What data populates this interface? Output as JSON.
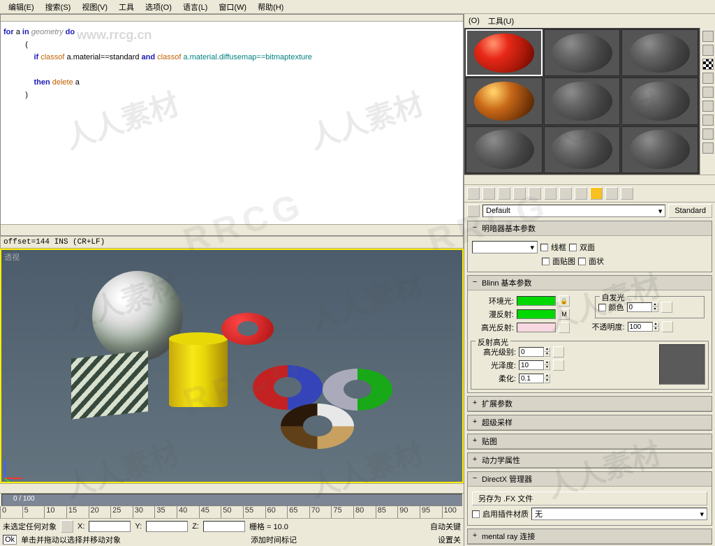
{
  "menubar": {
    "edit": "编辑(E)",
    "search": "搜索(S)",
    "view": "视图(V)",
    "tools": "工具",
    "options": "选项(O)",
    "language": "语言(L)",
    "window": "窗口(W)",
    "help": "帮助(H)"
  },
  "watermark_url": "www.rrcg.cn",
  "watermark_text": "人人素材",
  "script": {
    "line1a": "for",
    "line1b": " a ",
    "line1c": "in",
    "line1d": " geometry ",
    "line1e": "do",
    "line2": "(",
    "line3a": "    if",
    "line3b": " classof",
    "line3c": " a.material==standard ",
    "line3d": "and",
    "line3e": " classof",
    "line3f": " a.material.diffusemap==bitmaptexture",
    "line4a": "    then",
    "line4b": " delete",
    "line4c": " a",
    "line5": ")"
  },
  "status_line": "offset=144 INS (CR+LF)",
  "viewport_label": "透视",
  "timeline": {
    "range": "0 / 100",
    "ticks": [
      "0",
      "5",
      "10",
      "15",
      "20",
      "25",
      "30",
      "35",
      "40",
      "45",
      "50",
      "55",
      "60",
      "65",
      "70",
      "75",
      "80",
      "85",
      "90",
      "95",
      "100"
    ]
  },
  "bottom": {
    "no_selection": "未选定任何对象",
    "hint": "单击并拖动以选择并移动对象",
    "x": "X:",
    "y": "Y:",
    "z": "Z:",
    "grid_label": "栅格 = 10.0",
    "add_marker": "添加时间标记",
    "auto_key": "自动关键",
    "settings": "设置关"
  },
  "material_top": {
    "o": "(O)",
    "tools": "工具(U)"
  },
  "material": {
    "name": "Default",
    "type_btn": "Standard",
    "shader_params": "明暗器基本参数",
    "wireframe": "线框",
    "two_sided": "双面",
    "facemap": "面贴图",
    "faceted": "面状",
    "blinn_params": "Blinn 基本参数",
    "self_illum": "自发光",
    "color_chk": "颜色",
    "color_val": "0",
    "ambient": "环境光:",
    "diffuse": "漫反射:",
    "specular_c": "高光反射:",
    "opacity": "不透明度:",
    "opacity_val": "100",
    "spec_highlights": "反射高光",
    "spec_level": "高光级别:",
    "spec_level_val": "0",
    "glossiness": "光泽度:",
    "glossiness_val": "10",
    "soften": "柔化:",
    "soften_val": "0.1",
    "extended": "扩展参数",
    "supersample": "超级采样",
    "maps": "贴图",
    "dynamics": "动力学属性",
    "directx": "DirectX 管理器",
    "save_fx": "另存为 .FX 文件",
    "enable_plugin": "启用插件材质",
    "none": "无",
    "mentalray": "mental ray 连接"
  }
}
